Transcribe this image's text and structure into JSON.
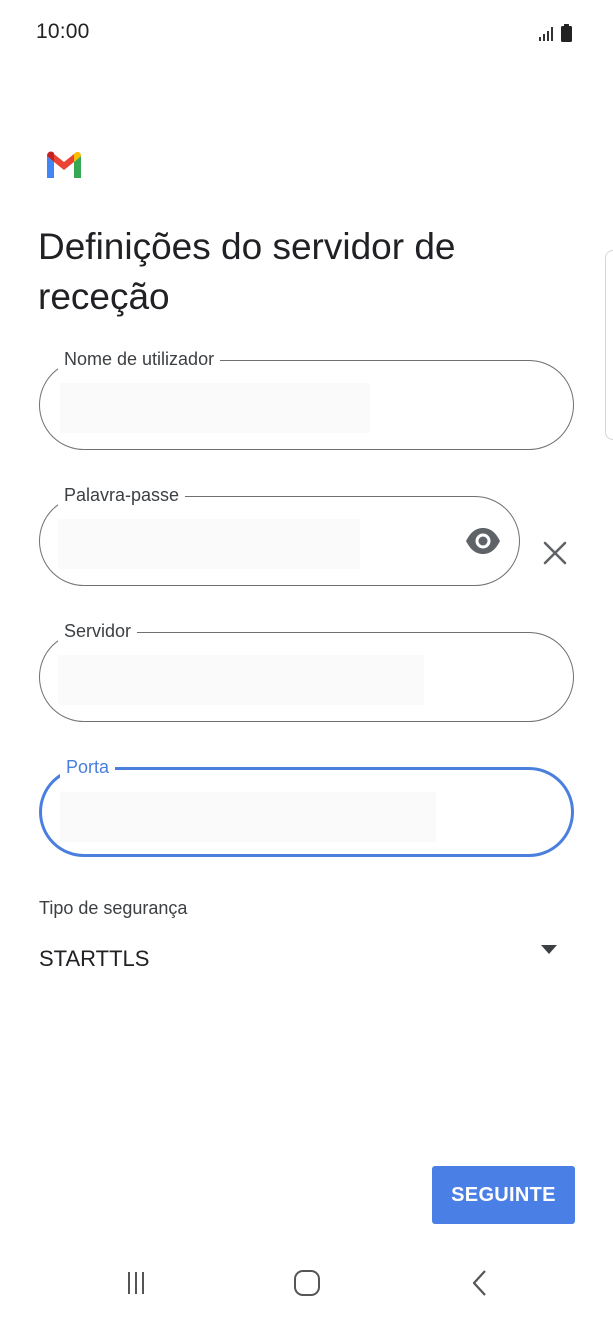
{
  "status_bar": {
    "time": "10:00",
    "icons": [
      "signal-icon",
      "battery-icon"
    ]
  },
  "app": {
    "logo": "gmail-logo-icon"
  },
  "page": {
    "title": "Definições do servidor de receção"
  },
  "form": {
    "username": {
      "label": "Nome de utilizador",
      "value": ""
    },
    "password": {
      "label": "Palavra-passe",
      "value": "",
      "toggle_icon": "eye-icon",
      "clear_icon": "close-icon"
    },
    "server": {
      "label": "Servidor",
      "value": ""
    },
    "port": {
      "label": "Porta",
      "value": "",
      "focused": true
    },
    "security": {
      "label": "Tipo de segurança",
      "value": "STARTTLS"
    }
  },
  "actions": {
    "next_label": "SEGUINTE"
  },
  "nav_bar": {
    "icons": [
      "recent-apps-icon",
      "home-icon",
      "back-icon"
    ]
  },
  "colors": {
    "accent": "#4a7fe6",
    "focus_border": "#4a7fde",
    "field_border": "#707070",
    "text": "#202124"
  }
}
